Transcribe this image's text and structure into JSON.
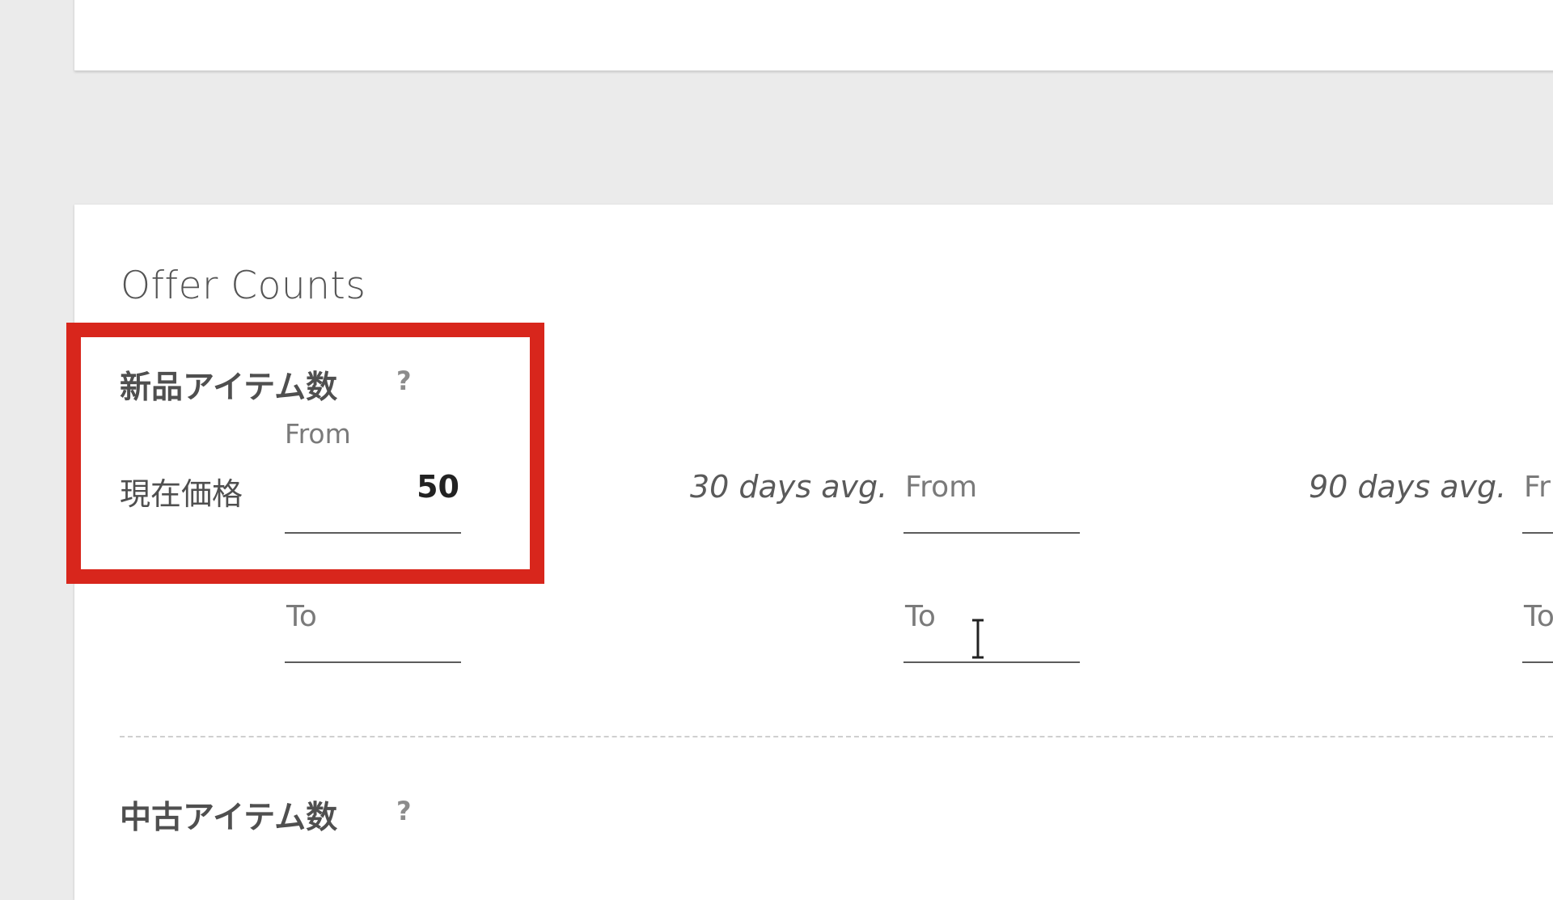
{
  "section": {
    "title": "Offer Counts"
  },
  "new_items": {
    "title": "新品アイテム数",
    "help": "?",
    "row_label": "現在価格",
    "current": {
      "from_label": "From",
      "from_value": "50",
      "to_label": "To",
      "to_value": ""
    },
    "avg30": {
      "label": "30 days avg.",
      "from_label": "From",
      "to_label": "To"
    },
    "avg90": {
      "label": "90 days avg.",
      "from_label": "Fr",
      "to_label": "To"
    }
  },
  "used_items": {
    "title": "中古アイテム数",
    "help": "?"
  },
  "colors": {
    "highlight": "#d8261c",
    "background": "#ebebeb",
    "card": "#ffffff"
  }
}
